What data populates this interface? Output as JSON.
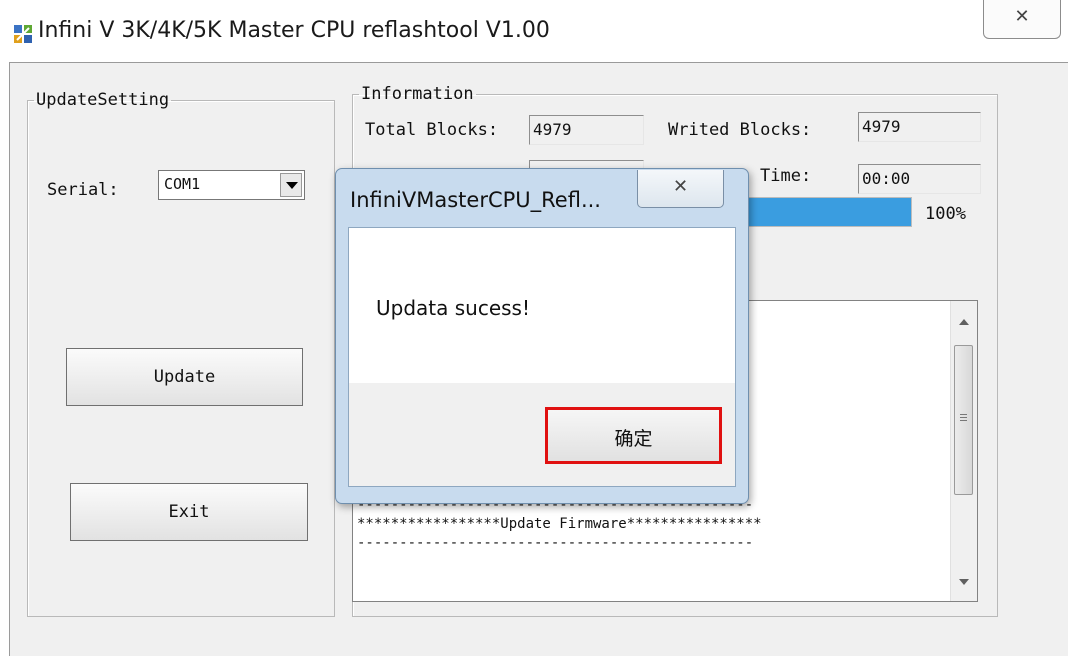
{
  "window": {
    "title": "Infini V 3K/4K/5K Master CPU reflashtool V1.00",
    "close_glyph": "✕"
  },
  "update_setting": {
    "legend": "UpdateSetting",
    "serial_label": "Serial:",
    "serial_value": "COM1",
    "update_button": "Update",
    "exit_button": "Exit"
  },
  "information": {
    "legend": "Information",
    "total_blocks_label": "Total Blocks:",
    "total_blocks_value": "4979",
    "writed_blocks_label": "Writed Blocks:",
    "writed_blocks_value": "4979",
    "time_label": "Time:",
    "time_value": "00:00",
    "progress_percent": 100,
    "progress_text": "100%"
  },
  "log": {
    "lines": [
      "-----------------------------------------------",
      "*****************Update Firmware****************",
      "-----------------------------------------------"
    ]
  },
  "dialog": {
    "title": "InfiniVMasterCPU_Refl...",
    "message": "Updata sucess!",
    "ok_button": "确定",
    "close_glyph": "✕",
    "highlight_color": "#e01010"
  },
  "colors": {
    "progress_fill": "#3a9de0",
    "window_bg": "#f0f0f0",
    "dialog_frame": "#c8dbee"
  }
}
